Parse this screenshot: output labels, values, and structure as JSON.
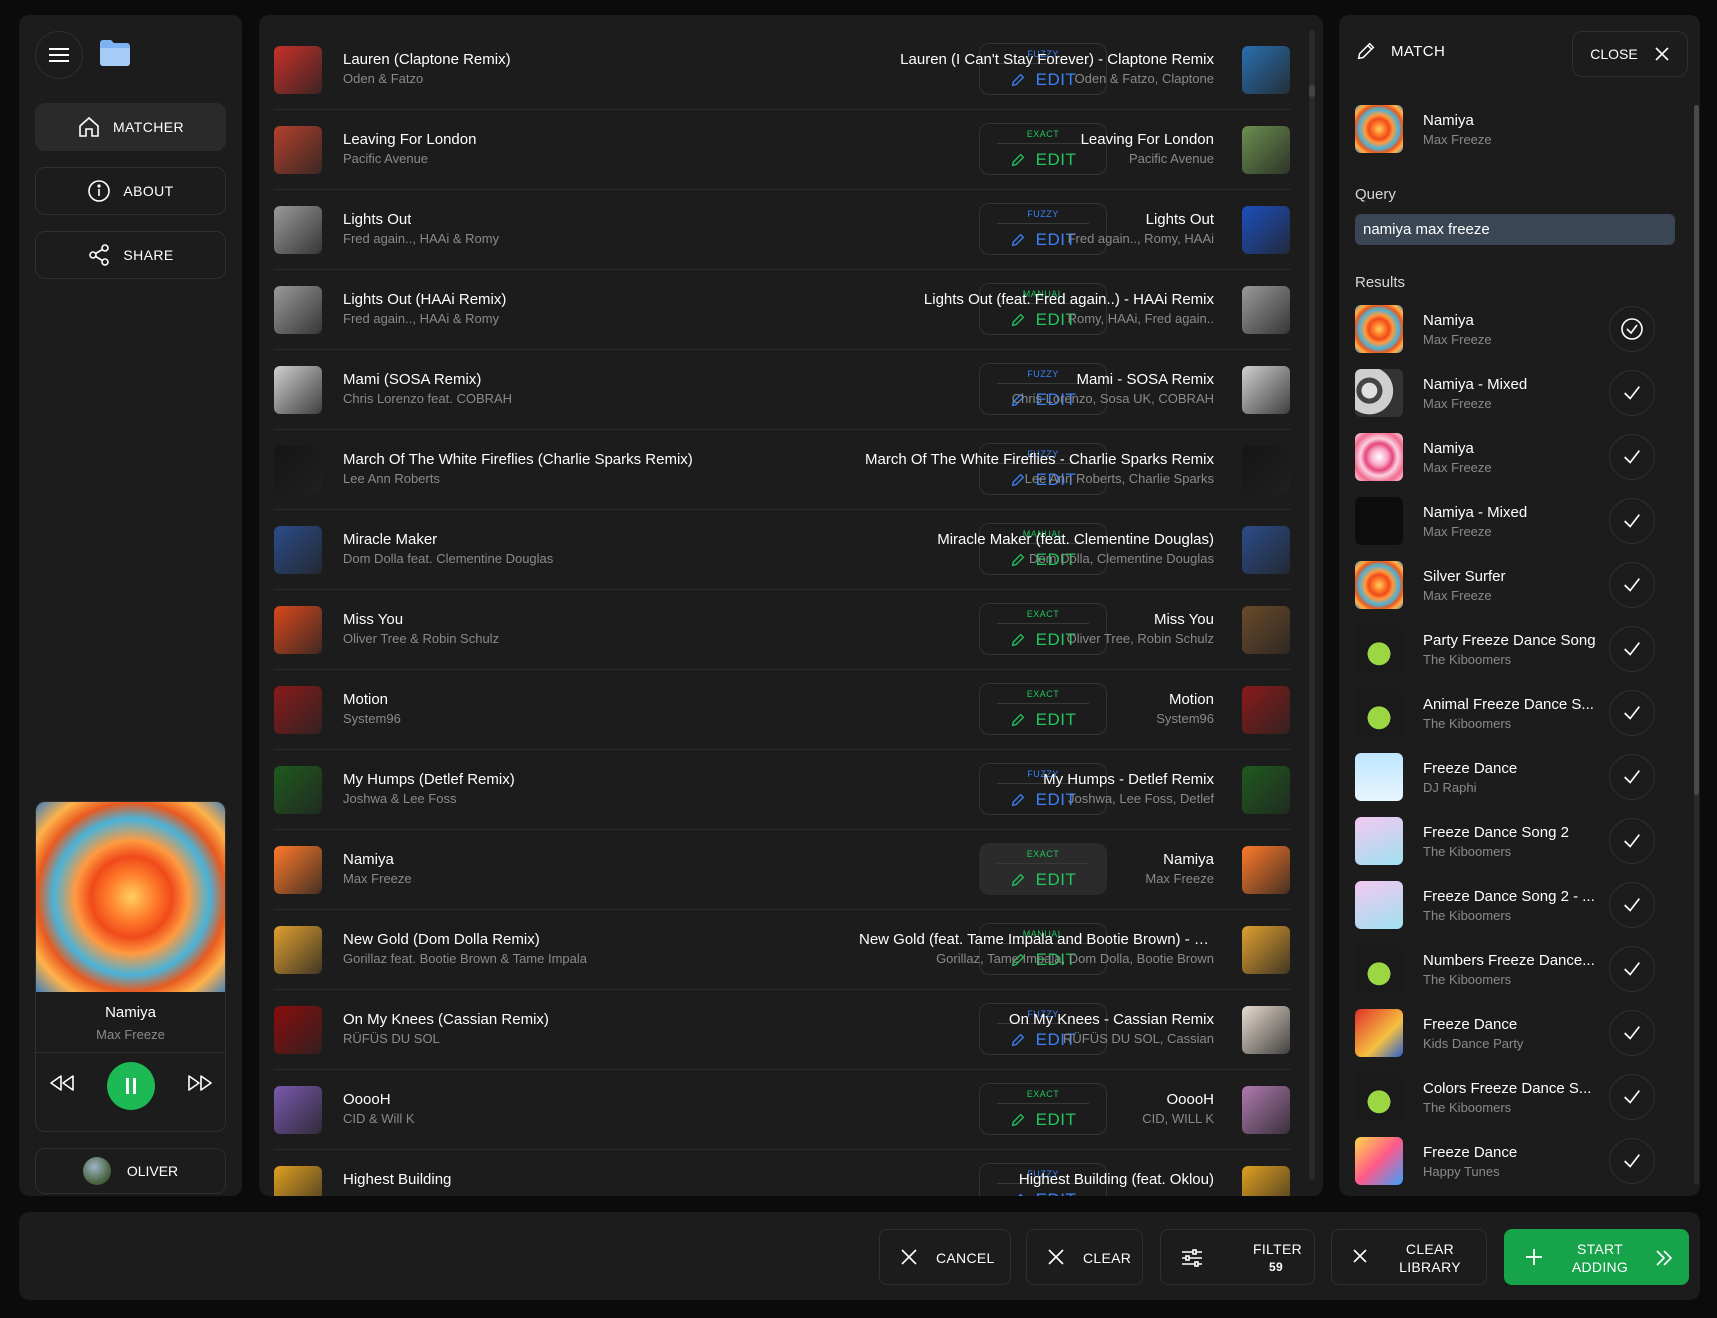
{
  "app": {
    "accent_green": "#1db954",
    "fuzzy_color": "#3b82f6",
    "exact_color": "#22c55e"
  },
  "sidebar": {
    "menu_icon": "hamburger-menu-icon",
    "folder_icon": "folder-icon",
    "nav": [
      {
        "label": "MATCHER",
        "icon": "home-icon",
        "active": true
      },
      {
        "label": "ABOUT",
        "icon": "info-icon",
        "active": false
      },
      {
        "label": "SHARE",
        "icon": "share-icon",
        "active": false
      }
    ],
    "player": {
      "title": "Namiya",
      "artist": "Max Freeze",
      "state": "playing"
    },
    "user": {
      "name": "OLIVER"
    }
  },
  "rows": [
    {
      "src_title": "Lauren (Claptone Remix)",
      "src_artist": "Oden & Fatzo",
      "match_type": "FUZZY",
      "edit_label": "EDIT",
      "dst_title": "Lauren (I Can't Stay Forever) - Claptone Remix",
      "dst_artist": "Oden & Fatzo, Claptone",
      "art": [
        "#c8302a",
        "#2a6fb0"
      ],
      "active": false
    },
    {
      "src_title": "Leaving For London",
      "src_artist": "Pacific Avenue",
      "match_type": "EXACT",
      "edit_label": "EDIT",
      "dst_title": "Leaving For London",
      "dst_artist": "Pacific Avenue",
      "art": [
        "#b4412c",
        "#6b8f4f"
      ],
      "active": false
    },
    {
      "src_title": "Lights Out",
      "src_artist": "Fred again.., HAAi & Romy",
      "match_type": "FUZZY",
      "edit_label": "EDIT",
      "dst_title": "Lights Out",
      "dst_artist": "Fred again.., Romy, HAAi",
      "art": [
        "#9a9a9a",
        "#1d4fbf"
      ],
      "active": false
    },
    {
      "src_title": "Lights Out (HAAi Remix)",
      "src_artist": "Fred again.., HAAi & Romy",
      "match_type": "MANUAL",
      "edit_label": "EDIT",
      "dst_title": "Lights Out (feat. Fred again..) - HAAi Remix",
      "dst_artist": "Romy, HAAi, Fred again..",
      "art": [
        "#9a9a9a",
        "#9a9a9a"
      ],
      "active": false
    },
    {
      "src_title": "Mami (SOSA Remix)",
      "src_artist": "Chris Lorenzo feat. COBRAH",
      "match_type": "FUZZY",
      "edit_label": "EDIT",
      "dst_title": "Mami - SOSA Remix",
      "dst_artist": "Chris Lorenzo, Sosa UK, COBRAH",
      "art": [
        "#d0d0d0",
        "#d0d0d0"
      ],
      "active": false
    },
    {
      "src_title": "March Of The White Fireflies (Charlie Sparks Remix)",
      "src_artist": "Lee Ann Roberts",
      "match_type": "FUZZY",
      "edit_label": "EDIT",
      "dst_title": "March Of The White Fireflies - Charlie Sparks Remix",
      "dst_artist": "Lee Ann Roberts, Charlie Sparks",
      "art": [
        "#151515",
        "#151515"
      ],
      "active": false
    },
    {
      "src_title": "Miracle Maker",
      "src_artist": "Dom Dolla feat. Clementine Douglas",
      "match_type": "MANUAL",
      "edit_label": "EDIT",
      "dst_title": "Miracle Maker (feat. Clementine Douglas)",
      "dst_artist": "Dom Dolla, Clementine Douglas",
      "art": [
        "#2b4c8a",
        "#2b4c8a"
      ],
      "active": false
    },
    {
      "src_title": "Miss You",
      "src_artist": "Oliver Tree & Robin Schulz",
      "match_type": "EXACT",
      "edit_label": "EDIT",
      "dst_title": "Miss You",
      "dst_artist": "Oliver Tree, Robin Schulz",
      "art": [
        "#d9481d",
        "#6b4a2a"
      ],
      "active": false
    },
    {
      "src_title": "Motion",
      "src_artist": "System96",
      "match_type": "EXACT",
      "edit_label": "EDIT",
      "dst_title": "Motion",
      "dst_artist": "System96",
      "art": [
        "#8a1a1a",
        "#8a1a1a"
      ],
      "active": false
    },
    {
      "src_title": "My Humps (Detlef Remix)",
      "src_artist": "Joshwa & Lee Foss",
      "match_type": "FUZZY",
      "edit_label": "EDIT",
      "dst_title": "My Humps - Detlef Remix",
      "dst_artist": "Joshwa, Lee Foss, Detlef",
      "art": [
        "#1d5a1d",
        "#1d5a1d"
      ],
      "active": false
    },
    {
      "src_title": "Namiya",
      "src_artist": "Max Freeze",
      "match_type": "EXACT",
      "edit_label": "EDIT",
      "dst_title": "Namiya",
      "dst_artist": "Max Freeze",
      "art": [
        "#ff7a2a",
        "#ff7a2a"
      ],
      "active": true
    },
    {
      "src_title": "New Gold (Dom Dolla Remix)",
      "src_artist": "Gorillaz feat. Bootie Brown & Tame Impala",
      "match_type": "MANUAL",
      "edit_label": "EDIT",
      "dst_title": "New Gold (feat. Tame Impala and Bootie Brown) - Dom Dolla Remix",
      "dst_artist": "Gorillaz, Tame Impala, Dom Dolla, Bootie Brown",
      "art": [
        "#e0a030",
        "#e0a030"
      ],
      "active": false
    },
    {
      "src_title": "On My Knees (Cassian Remix)",
      "src_artist": "RÜFÜS DU SOL",
      "match_type": "FUZZY",
      "edit_label": "EDIT",
      "dst_title": "On My Knees - Cassian Remix",
      "dst_artist": "RÜFÜS DU SOL, Cassian",
      "art": [
        "#8a0d0d",
        "#e8dcd0"
      ],
      "active": false
    },
    {
      "src_title": "OoooH",
      "src_artist": "CID & Will K",
      "match_type": "EXACT",
      "edit_label": "EDIT",
      "dst_title": "OoooH",
      "dst_artist": "CID, WILL K",
      "art": [
        "#7a5ab0",
        "#b07ab0"
      ],
      "active": false
    },
    {
      "src_title": "Highest Building",
      "src_artist": "",
      "match_type": "FUZZY",
      "edit_label": "EDIT",
      "dst_title": "Highest Building (feat. Oklou)",
      "dst_artist": "",
      "art": [
        "#e0a020",
        "#e0a020"
      ],
      "active": false
    }
  ],
  "panel": {
    "title": "MATCH",
    "close_label": "CLOSE",
    "selected": {
      "title": "Namiya",
      "artist": "Max Freeze"
    },
    "query_label": "Query",
    "query_value": "namiya max freeze",
    "results_label": "Results",
    "results": [
      {
        "title": "Namiya",
        "artist": "Max Freeze",
        "selected": true,
        "art": "swirl"
      },
      {
        "title": "Namiya - Mixed",
        "artist": "Max Freeze",
        "selected": false,
        "art": "photo"
      },
      {
        "title": "Namiya",
        "artist": "Max Freeze",
        "selected": false,
        "art": "swirl-pink"
      },
      {
        "title": "Namiya - Mixed",
        "artist": "Max Freeze",
        "selected": false,
        "art": "dark"
      },
      {
        "title": "Silver Surfer",
        "artist": "Max Freeze",
        "selected": false,
        "art": "swirl"
      },
      {
        "title": "Party Freeze Dance Song",
        "artist": "The Kiboomers",
        "selected": false,
        "art": "kiboomers"
      },
      {
        "title": "Animal Freeze Dance S...",
        "artist": "The Kiboomers",
        "selected": false,
        "art": "kiboomers"
      },
      {
        "title": "Freeze Dance",
        "artist": "DJ Raphi",
        "selected": false,
        "art": "raphi"
      },
      {
        "title": "Freeze Dance Song 2",
        "artist": "The Kiboomers",
        "selected": false,
        "art": "kiboomers2"
      },
      {
        "title": "Freeze Dance Song 2 - ...",
        "artist": "The Kiboomers",
        "selected": false,
        "art": "kiboomers2"
      },
      {
        "title": "Numbers Freeze Dance...",
        "artist": "The Kiboomers",
        "selected": false,
        "art": "kiboomers"
      },
      {
        "title": "Freeze Dance",
        "artist": "Kids Dance Party",
        "selected": false,
        "art": "kids"
      },
      {
        "title": "Colors Freeze Dance S...",
        "artist": "The Kiboomers",
        "selected": false,
        "art": "kiboomers"
      },
      {
        "title": "Freeze Dance",
        "artist": "Happy Tunes",
        "selected": false,
        "art": "happy"
      }
    ]
  },
  "bottombar": {
    "cancel_label": "CANCEL",
    "clear_label": "CLEAR",
    "filter_label": "FILTER",
    "filter_count": "59",
    "clear_library_line1": "CLEAR",
    "clear_library_line2": "LIBRARY",
    "start_line1": "START",
    "start_line2": "ADDING"
  }
}
